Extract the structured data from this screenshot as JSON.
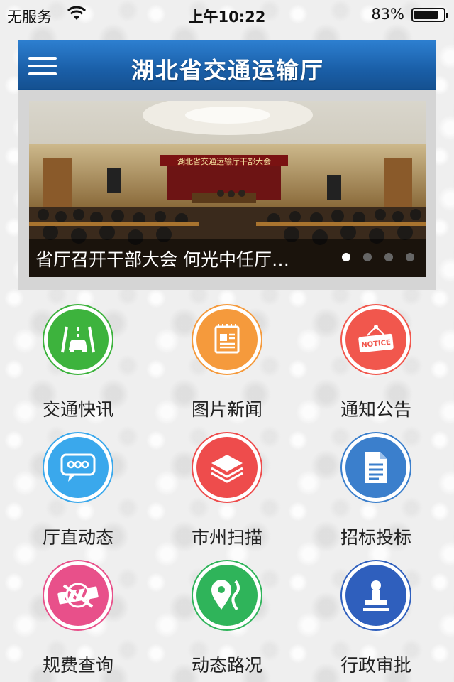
{
  "status_bar": {
    "carrier": "无服务",
    "time": "上午10:22",
    "battery_percent": "83%",
    "battery_level": 0.83
  },
  "header": {
    "title": "湖北省交通运输厅"
  },
  "banner": {
    "caption": "省厅召开干部大会 何光中任厅…",
    "photo_sign": "湖北省交通运输厅干部大会",
    "slide_count": 4,
    "active_slide": 1
  },
  "tiles": [
    {
      "label": "交通快讯",
      "icon": "road-car-icon",
      "color": "#3db33d"
    },
    {
      "label": "图片新闻",
      "icon": "newspaper-icon",
      "color": "#f59a3c"
    },
    {
      "label": "通知公告",
      "icon": "notice-sign-icon",
      "color": "#f1574d"
    },
    {
      "label": "厅直动态",
      "icon": "chat-bubble-icon",
      "color": "#3aa8ec"
    },
    {
      "label": "市州扫描",
      "icon": "layers-icon",
      "color": "#ee4c4c"
    },
    {
      "label": "招标投标",
      "icon": "document-icon",
      "color": "#3b7fcc"
    },
    {
      "label": "规费查询",
      "icon": "toll-barrier-icon",
      "color": "#e8508a"
    },
    {
      "label": "动态路况",
      "icon": "map-pin-road-icon",
      "color": "#2fb45a"
    },
    {
      "label": "行政审批",
      "icon": "stamp-icon",
      "color": "#2f5fbd"
    }
  ]
}
